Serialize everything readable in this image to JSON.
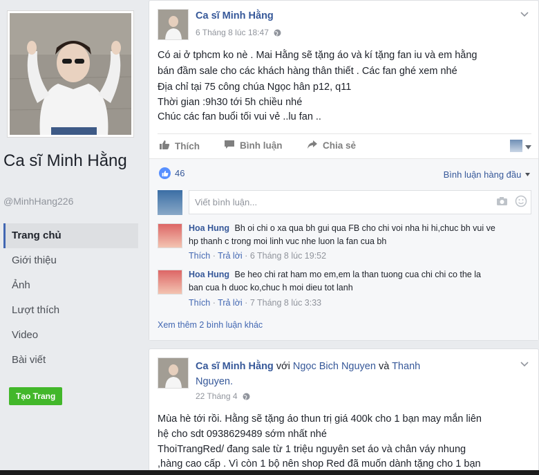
{
  "page": {
    "name": "Ca sĩ Minh Hằng",
    "handle": "@MinhHang226",
    "create_page_label": "Tạo Trang"
  },
  "nav": {
    "items": [
      {
        "label": "Trang chủ"
      },
      {
        "label": "Giới thiệu"
      },
      {
        "label": "Ảnh"
      },
      {
        "label": "Lượt thích"
      },
      {
        "label": "Video"
      },
      {
        "label": "Bài viết"
      }
    ]
  },
  "post1": {
    "author": "Ca sĩ Minh Hằng",
    "time": "6 Tháng 8 lúc 18:47",
    "lines": [
      "Có ai ở tphcm ko nè . Mai Hằng sẽ tặng áo và kí tặng fan iu và em hằng",
      "bán đầm sale cho các khách hàng thân thiết . Các fan ghé xem nhé",
      "Địa chỉ tại 75 công chúa Ngọc hân p12, q11",
      "Thời gian :9h30 tới 5h chiều nhé",
      "Chúc các fan buổi tối vui vẻ ..lu fan .."
    ],
    "actions": {
      "like": "Thích",
      "comment": "Bình luận",
      "share": "Chia sẻ"
    },
    "like_count": "46",
    "sort_label": "Bình luận hàng đầu",
    "comment_placeholder": "Viết bình luận...",
    "comments": [
      {
        "name": "Hoa Hung",
        "line1": "Bh oi chi o xa qua bh gui qua FB cho chi voi nha hi hi,chuc bh vui ve",
        "line2": "hp thanh c trong moi linh vuc nhe luon la fan cua bh",
        "like": "Thích",
        "reply": "Trả lời",
        "time": "6 Tháng 8 lúc 19:52"
      },
      {
        "name": "Hoa Hung",
        "line1": "Be heo chi rat ham mo em,em la than tuong cua chi chi co the la",
        "line2": "ban cua h duoc ko,chuc h moi dieu tot lanh",
        "like": "Thích",
        "reply": "Trả lời",
        "time": "7 Tháng 8 lúc 3:33"
      }
    ],
    "see_more": "Xem thêm 2 bình luận khác"
  },
  "post2": {
    "author": "Ca sĩ Minh Hằng",
    "with_word": "với",
    "tag1": "Ngọc Bich Nguyen",
    "and_word": "và",
    "tag2_part1": "Thanh",
    "tag2_part2": "Nguyen.",
    "time": "22 Tháng 4",
    "lines": [
      "Mùa hè tới rồi. Hằng sẽ tặng áo thun trị giá 400k cho 1 bạn may mắn liên",
      "hệ cho sdt 0938629489 sớm nhất nhé",
      "ThoiTrangRed/ đang sale từ 1 triệu nguyên set áo và chân váy nhung",
      ",hàng cao cấp . Vì còn 1 bộ nên shop Red đã muốn dành tặng cho 1 bạn"
    ]
  },
  "colors": {
    "link": "#365899",
    "accent": "#4267b2",
    "green": "#42b72a",
    "bg": "#e9ebee"
  }
}
